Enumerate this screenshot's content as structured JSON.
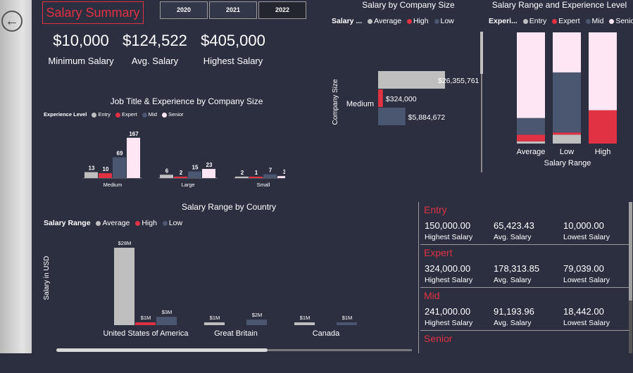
{
  "nav": {
    "back_label": "Back"
  },
  "header": {
    "title": "Salary Summary",
    "years": [
      "2020",
      "2021",
      "2022"
    ],
    "selected_year": "2022"
  },
  "kpis": [
    {
      "value": "$10,000",
      "label": "Minimum Salary"
    },
    {
      "value": "$124,522",
      "label": "Avg. Salary"
    },
    {
      "value": "$405,000",
      "label": "Highest Salary"
    }
  ],
  "colors": {
    "average": "#bfbfbf",
    "high": "#e03242",
    "low": "#4b5670",
    "entry": "#bfbfbf",
    "expert": "#e03242",
    "mid": "#4b5670",
    "senior": "#ffe6f5",
    "accent": "#e03242",
    "background": "#2c2f40"
  },
  "chart_data": [
    {
      "type": "bar",
      "title": "Job Title & Experience by Company Size",
      "legend_title": "Experience Level",
      "legend": [
        "Entry",
        "Expert",
        "Mid",
        "Senior"
      ],
      "categories": [
        "Medium",
        "Large",
        "Small"
      ],
      "series": [
        {
          "name": "Entry",
          "values": [
            13,
            6,
            2
          ]
        },
        {
          "name": "Expert",
          "values": [
            10,
            2,
            1
          ]
        },
        {
          "name": "Mid",
          "values": [
            69,
            15,
            7
          ]
        },
        {
          "name": "Senior",
          "values": [
            167,
            23,
            3
          ]
        }
      ],
      "ylim": [
        0,
        170
      ]
    },
    {
      "type": "bar",
      "orientation": "horizontal",
      "title": "Salary by Company Size",
      "legend_title": "Salary ...",
      "legend": [
        "Average",
        "High",
        "Low"
      ],
      "ylabel": "Company Size",
      "categories": [
        "Medium"
      ],
      "series": [
        {
          "name": "Average",
          "values": [
            26355761
          ],
          "label": "$26,355,761"
        },
        {
          "name": "High",
          "values": [
            324000
          ],
          "label": "$324,000"
        },
        {
          "name": "Low",
          "values": [
            5884672
          ],
          "label": "$5,884,672"
        }
      ],
      "xlim": [
        0,
        26355761
      ]
    },
    {
      "type": "bar",
      "stacked": "percent",
      "title": "Salary Range and Experience Level",
      "legend_title": "Experi...",
      "legend": [
        "Entry",
        "Expert",
        "Mid",
        "Senior"
      ],
      "xlabel": "Salary Range",
      "categories": [
        "Average",
        "Low",
        "High"
      ],
      "series": [
        {
          "name": "Entry",
          "values": [
            2,
            8,
            0
          ]
        },
        {
          "name": "Expert",
          "values": [
            6,
            2,
            30
          ]
        },
        {
          "name": "Mid",
          "values": [
            15,
            54,
            0
          ]
        },
        {
          "name": "Senior",
          "values": [
            77,
            36,
            70
          ]
        }
      ]
    },
    {
      "type": "bar",
      "title": "Salary Range by Country",
      "legend_title": "Salary Range",
      "legend": [
        "Average",
        "High",
        "Low"
      ],
      "ylabel": "Salary in USD",
      "categories": [
        "United States of America",
        "Great Britain",
        "Canada"
      ],
      "series": [
        {
          "name": "Average",
          "values": [
            28,
            1,
            1
          ],
          "labels": [
            "$28M",
            "$1M",
            "$1M"
          ]
        },
        {
          "name": "High",
          "values": [
            1,
            0,
            0
          ],
          "labels": [
            "$1M",
            "",
            ""
          ]
        },
        {
          "name": "Low",
          "values": [
            3,
            2,
            1
          ],
          "labels": [
            "$3M",
            "$2M",
            "$1M"
          ]
        }
      ],
      "ylim": [
        0,
        28
      ]
    }
  ],
  "level_cards": [
    {
      "title": "Entry",
      "stats": [
        {
          "value": "150,000.00",
          "label": "Highest Salary"
        },
        {
          "value": "65,423.43",
          "label": "Avg. Salary"
        },
        {
          "value": "10,000.00",
          "label": "Lowest Salary"
        }
      ]
    },
    {
      "title": "Expert",
      "stats": [
        {
          "value": "324,000.00",
          "label": "Highest Salary"
        },
        {
          "value": "178,313.85",
          "label": "Avg. Salary"
        },
        {
          "value": "79,039.00",
          "label": "Lowest Salary"
        }
      ]
    },
    {
      "title": "Mid",
      "stats": [
        {
          "value": "241,000.00",
          "label": "Highest Salary"
        },
        {
          "value": "91,193.96",
          "label": "Avg. Salary"
        },
        {
          "value": "18,442.00",
          "label": "Lowest Salary"
        }
      ]
    },
    {
      "title": "Senior",
      "stats": []
    }
  ]
}
